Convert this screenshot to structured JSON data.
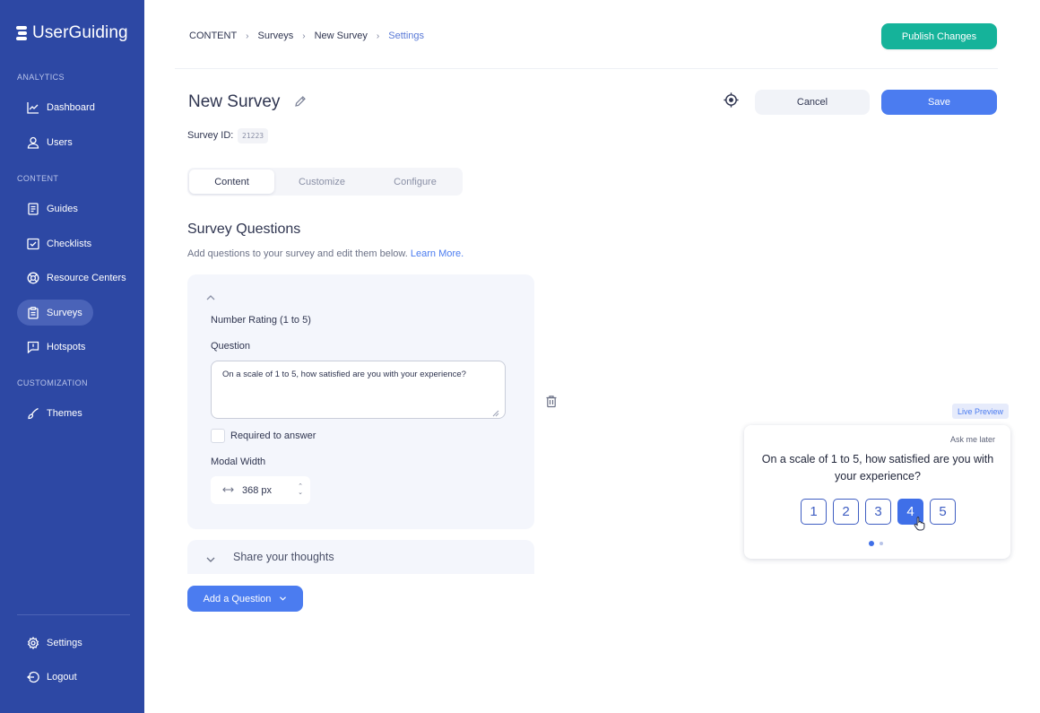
{
  "sidebar": {
    "brand": "UserGuiding",
    "sections": {
      "analytics": "ANALYTICS",
      "content": "CONTENT",
      "customization": "CUSTOMIZATION"
    },
    "items": {
      "dashboard": "Dashboard",
      "users": "Users",
      "guides": "Guides",
      "checklists": "Checklists",
      "resource_centers": "Resource Centers",
      "surveys": "Surveys",
      "hotspots": "Hotspots",
      "themes": "Themes",
      "settings": "Settings",
      "logout": "Logout"
    },
    "active_item": "surveys",
    "colors": {
      "background": "#2d48a4",
      "active": "#4a63b8"
    }
  },
  "header": {
    "breadcrumb": [
      "CONTENT",
      "Surveys",
      "New Survey",
      "Settings"
    ],
    "publish_label": "Publish Changes"
  },
  "survey": {
    "title": "New Survey",
    "id_label": "Survey ID:",
    "id_value": "21223",
    "cancel_label": "Cancel",
    "save_label": "Save"
  },
  "tabs": [
    "Content",
    "Customize",
    "Configure"
  ],
  "active_tab": "Content",
  "questions": {
    "title": "Survey Questions",
    "description": "Add questions to your survey and edit them below.",
    "learn_more": "Learn More.",
    "items": [
      {
        "type": "Number Rating (1 to 5)",
        "question_label": "Question",
        "question_value": "On a scale of 1 to 5, how satisfied are you with your experience?",
        "required_label": "Required to answer",
        "required": false,
        "modal_width_label": "Modal Width",
        "modal_width_value": "368 px"
      },
      {
        "type": "Share your thoughts"
      }
    ],
    "add_label": "Add a Question"
  },
  "preview": {
    "badge": "Live Preview",
    "ask_later": "Ask me later",
    "question": "On a scale of 1 to 5, how satisfied are you with your experience?",
    "ratings": [
      "1",
      "2",
      "3",
      "4",
      "5"
    ],
    "selected_rating": "4",
    "page_dots": 2,
    "active_dot": 1
  },
  "colors": {
    "primary": "#4b7cf0",
    "publish": "#15b39a",
    "card_bg": "#f4f6fc"
  }
}
